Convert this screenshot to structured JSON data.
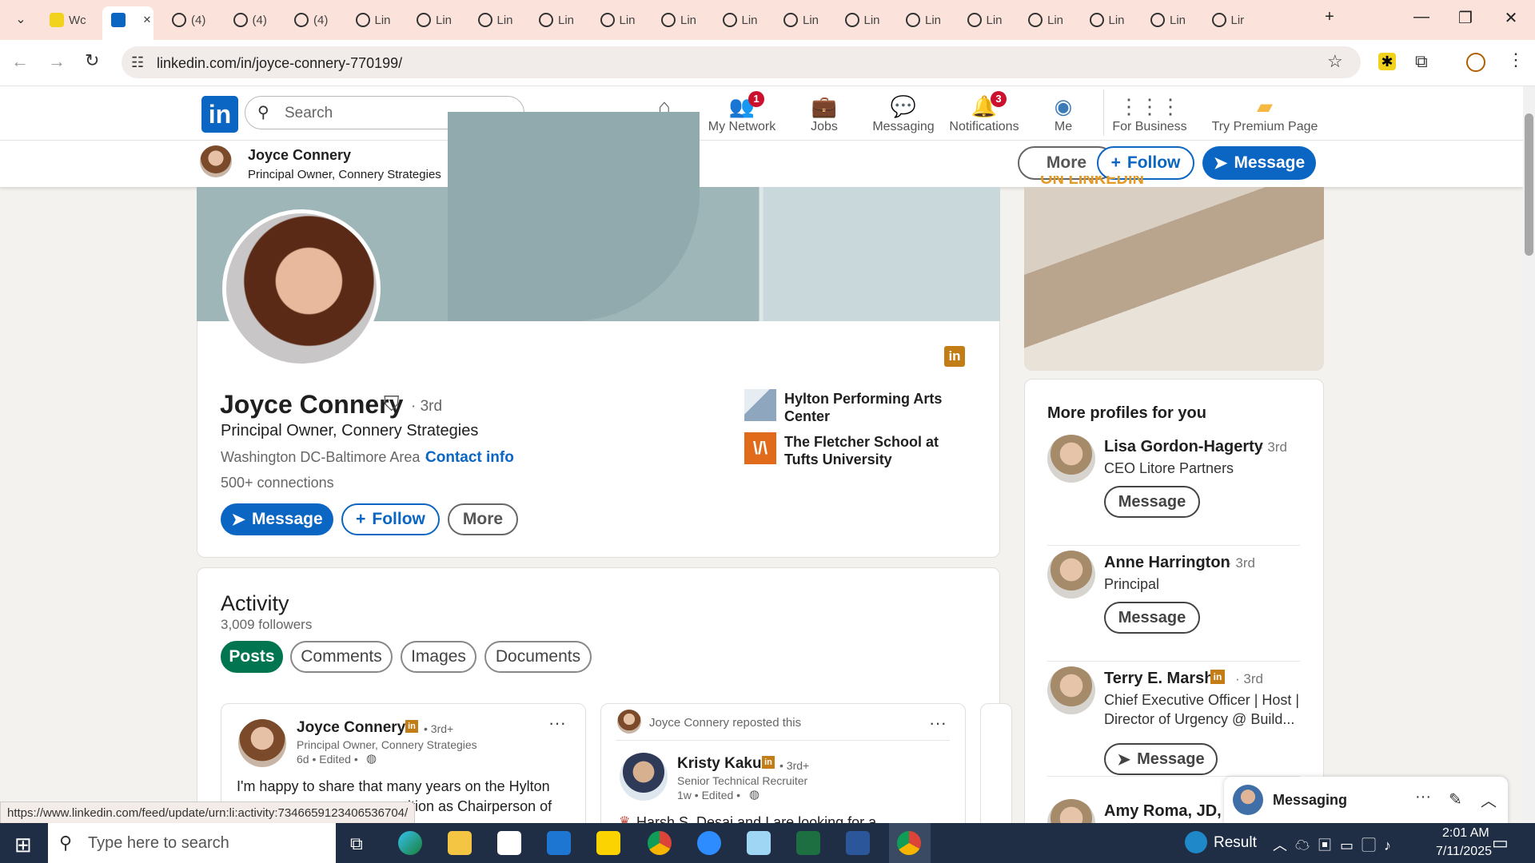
{
  "browser": {
    "tabs": [
      {
        "label": "Wc",
        "icon": "sparkle-icon"
      },
      {
        "label": "",
        "icon": "linkedin-icon",
        "close": "✕"
      },
      {
        "label": "(4)",
        "icon": "threads-icon"
      },
      {
        "label": "(4)",
        "icon": "threads-icon"
      },
      {
        "label": "(4)",
        "icon": "threads-icon"
      },
      {
        "label": "Lin",
        "icon": "threads-icon"
      },
      {
        "label": "Lin",
        "icon": "threads-icon"
      },
      {
        "label": "Lin",
        "icon": "threads-icon"
      },
      {
        "label": "Lin",
        "icon": "threads-icon"
      },
      {
        "label": "Lin",
        "icon": "threads-icon"
      },
      {
        "label": "Lin",
        "icon": "threads-icon"
      },
      {
        "label": "Lin",
        "icon": "threads-icon"
      },
      {
        "label": "Lin",
        "icon": "threads-icon"
      },
      {
        "label": "Lin",
        "icon": "threads-icon"
      },
      {
        "label": "Lin",
        "icon": "threads-icon"
      },
      {
        "label": "Lin",
        "icon": "threads-icon"
      },
      {
        "label": "Lin",
        "icon": "threads-icon"
      },
      {
        "label": "Lin",
        "icon": "threads-icon"
      },
      {
        "label": "Lin",
        "icon": "threads-icon"
      },
      {
        "label": "Lir",
        "icon": "threads-icon"
      }
    ],
    "url": "linkedin.com/in/joyce-connery-770199/",
    "status_url": "https://www.linkedin.com/feed/update/urn:li:activity:7346659123406536704/"
  },
  "li_nav": {
    "search_placeholder": "Search",
    "items": [
      {
        "label": "Home",
        "badge": "",
        "icon": "home-icon"
      },
      {
        "label": "My Network",
        "badge": "1",
        "icon": "network-icon"
      },
      {
        "label": "Jobs",
        "badge": "",
        "icon": "briefcase-icon"
      },
      {
        "label": "Messaging",
        "badge": "",
        "icon": "chat-icon"
      },
      {
        "label": "Notifications",
        "badge": "3",
        "icon": "bell-icon"
      },
      {
        "label": "Me",
        "badge": "",
        "icon": "avatar"
      },
      {
        "label": "For Business",
        "badge": "",
        "icon": "grid-icon"
      },
      {
        "label": "Try Premium Page",
        "badge": "",
        "icon": "premium-icon"
      }
    ]
  },
  "sticky": {
    "name": "Joyce Connery",
    "headline": "Principal Owner, Connery Strategies",
    "more": "More",
    "follow": "Follow",
    "message": "Message"
  },
  "profile": {
    "name": "Joyce Connery",
    "degree": "· 3rd",
    "headline": "Principal Owner, Connery Strategies",
    "location": "Washington DC-Baltimore Area ·",
    "contact": "Contact info",
    "connections": "500+ connections",
    "message": "Message",
    "follow": "Follow",
    "more": "More",
    "orgs": [
      {
        "name": "Hylton Performing Arts Center"
      },
      {
        "name": "The Fletcher School at Tufts University"
      }
    ]
  },
  "activity": {
    "title": "Activity",
    "followers": "3,009 followers",
    "tabs": [
      "Posts",
      "Comments",
      "Images",
      "Documents"
    ],
    "post1": {
      "author": "Joyce Connery",
      "degree": "• 3rd+",
      "sub": "Principal Owner, Connery Strategies",
      "meta": "6d • Edited •",
      "text1": "I'm happy to share that many years on the Hylton",
      "text2": "ition as Chairperson of"
    },
    "post2": {
      "repost": "Joyce Connery reposted this",
      "author": "Kristy Kaku",
      "degree": "• 3rd+",
      "sub": "Senior Technical Recruiter",
      "meta": "1w • Edited •",
      "text": "Harsh S. Desai and I are looking for a"
    }
  },
  "sidebar": {
    "ad_text": "ON LINKEDIN",
    "more_title": "More profiles for you",
    "profiles": [
      {
        "name": "Lisa Gordon-Hagerty",
        "degree": "· 3rd",
        "title": "CEO Litore Partners",
        "title2": "",
        "button": "Message"
      },
      {
        "name": "Anne Harrington",
        "degree": "· 3rd",
        "title": "Principal",
        "title2": "",
        "button": "Message"
      },
      {
        "name": "Terry E. Marsh",
        "degree": "· 3rd",
        "title": "Chief Executive Officer | Host |",
        "title2": "Director of Urgency @ Build...",
        "button": "Message"
      },
      {
        "name": "Amy Roma, JD, M",
        "degree": "",
        "title": "",
        "title2": "",
        "button": ""
      }
    ]
  },
  "messaging": {
    "label": "Messaging"
  },
  "taskbar": {
    "search_placeholder": "Type here to search",
    "weather": "Result",
    "time": "2:01 AM",
    "date": "7/11/2025"
  },
  "colors": {
    "brand": "#0a66c2",
    "green": "#01754f",
    "badge": "#cb112d"
  }
}
